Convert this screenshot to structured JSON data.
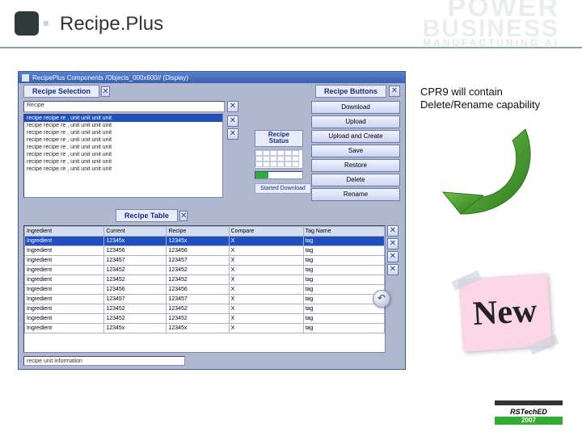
{
  "slide": {
    "title": "Recipe.Plus",
    "bg_words": [
      "POWER",
      "BUSINESS",
      "MANUFACTURING AI"
    ],
    "annotation_line1": "CPR9 will contain",
    "annotation_line2": "Delete/Rename capability",
    "sticker": "New",
    "footer_logo": "RSTechED",
    "footer_year": "2007"
  },
  "app": {
    "title": "RecipePlus Components /Objects_000x600// (Display)",
    "recipe_selection_label": "Recipe Selection",
    "recipe_field": "Recipe",
    "recipe_list": [
      "recipe recipe re , unit unit unit unit",
      "recipe recipe re , unit unit unit unit",
      "recipe recipe re , unit unit unit unit",
      "recipe recipe re , unit unit unit unit",
      "recipe recipe re , unit unit unit unit",
      "recipe recipe re , unit unit unit unit",
      "recipe recipe re , unit unit unit unit",
      "recipe recipe re , unit unit unit unit"
    ],
    "recipe_buttons_label": "Recipe Buttons",
    "buttons": {
      "download": "Download",
      "upload": "Upload",
      "upload_create": "Upload and Create",
      "save": "Save",
      "restore": "Restore",
      "delete": "Delete",
      "rename": "Rename"
    },
    "status_label": "Recipe Status",
    "status_msg": "Started Download",
    "table_label": "Recipe Table",
    "table": {
      "headers": [
        "Ingredient",
        "Current",
        "Recipe",
        "Compare",
        "Tag Name"
      ],
      "rows": [
        [
          "Ingredient",
          "12345x",
          "12345x",
          "X",
          "tag"
        ],
        [
          "Ingredient",
          "123456",
          "123456",
          "X",
          "tag"
        ],
        [
          "Ingredient",
          "123457",
          "123457",
          "X",
          "tag"
        ],
        [
          "Ingredient",
          "123452",
          "123452",
          "X",
          "tag"
        ],
        [
          "Ingredient",
          "123452",
          "123452",
          "X",
          "tag"
        ],
        [
          "Ingredient",
          "123456",
          "123456",
          "X",
          "tag"
        ],
        [
          "Ingredient",
          "123457",
          "123457",
          "X",
          "tag"
        ],
        [
          "Ingredient",
          "123452",
          "123452",
          "X",
          "tag"
        ],
        [
          "Ingredient",
          "123452",
          "123452",
          "X",
          "tag"
        ],
        [
          "Ingredient",
          "12345x",
          "12345x",
          "X",
          "tag"
        ]
      ]
    },
    "footer_field": "recipe unit information"
  }
}
